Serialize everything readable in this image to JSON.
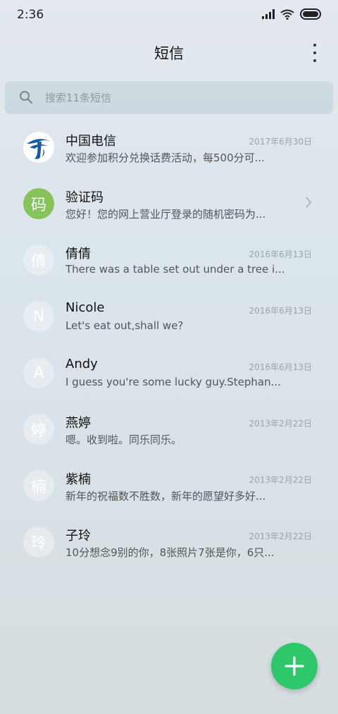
{
  "status": {
    "time": "2:36",
    "icons": [
      "signal-icon",
      "wifi-icon",
      "battery-icon"
    ]
  },
  "header": {
    "title": "短信",
    "more_icon": "more-vert-icon"
  },
  "search": {
    "placeholder": "搜索11条短信",
    "icon": "search-icon"
  },
  "colors": {
    "fab": "#2ec86a",
    "avatar_green": "#86c35a",
    "telecom_blue": "#1659a6"
  },
  "threads": [
    {
      "avatar": "",
      "avatar_icon": "china-telecom-logo-icon",
      "name": "中国电信",
      "snippet": "欢迎参加积分兑换话费活动，每500分可...",
      "date": "2017年6月30日"
    },
    {
      "avatar": "码",
      "name": "验证码",
      "snippet": "您好！您的网上营业厅登录的随机密码为...",
      "date": "",
      "chevron": "chevron-right-icon"
    },
    {
      "avatar": "倩",
      "name": "倩倩",
      "snippet": "There was a table set out under a tree i...",
      "date": "2016年6月13日"
    },
    {
      "avatar": "N",
      "name": "Nicole",
      "snippet": "Let's eat out,shall we?",
      "date": "2016年6月13日"
    },
    {
      "avatar": "A",
      "name": "Andy",
      "snippet": "I guess you're some lucky guy.Stephan...",
      "date": "2016年6月13日"
    },
    {
      "avatar": "婷",
      "name": "燕婷",
      "snippet": "嗯。收到啦。同乐同乐。",
      "date": "2013年2月22日"
    },
    {
      "avatar": "楠",
      "name": "紫楠",
      "snippet": "新年的祝福数不胜数，新年的愿望好多好...",
      "date": "2013年2月22日"
    },
    {
      "avatar": "玲",
      "name": "子玲",
      "snippet": "10分想念9别的你，8张照片7张是你，6只...",
      "date": "2013年2月22日"
    }
  ],
  "fab": {
    "icon": "plus-icon"
  }
}
